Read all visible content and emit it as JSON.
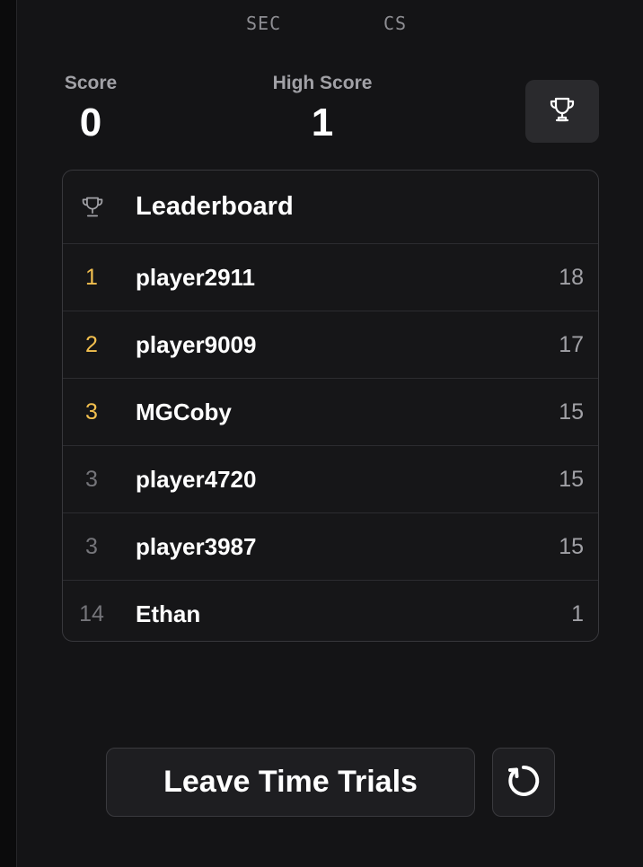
{
  "timer": {
    "units": [
      "SEC",
      "CS"
    ]
  },
  "stats": {
    "score_label": "Score",
    "score_value": "0",
    "high_score_label": "High Score",
    "high_score_value": "1"
  },
  "leaderboard": {
    "title": "Leaderboard",
    "rows": [
      {
        "rank": "1",
        "name": "player2911",
        "score": "18"
      },
      {
        "rank": "2",
        "name": "player9009",
        "score": "17"
      },
      {
        "rank": "3",
        "name": "MGCoby",
        "score": "15"
      },
      {
        "rank": "3",
        "name": "player4720",
        "score": "15"
      },
      {
        "rank": "3",
        "name": "player3987",
        "score": "15"
      },
      {
        "rank": "14",
        "name": "Ethan",
        "score": "1"
      }
    ]
  },
  "actions": {
    "leave_label": "Leave Time Trials",
    "trophy_icon": "trophy-icon",
    "restart_icon": "restart-icon"
  },
  "colors": {
    "background": "#141416",
    "gold_rank": "#f3c04f",
    "muted_rank": "#75757a",
    "panel_border": "#38383c"
  }
}
